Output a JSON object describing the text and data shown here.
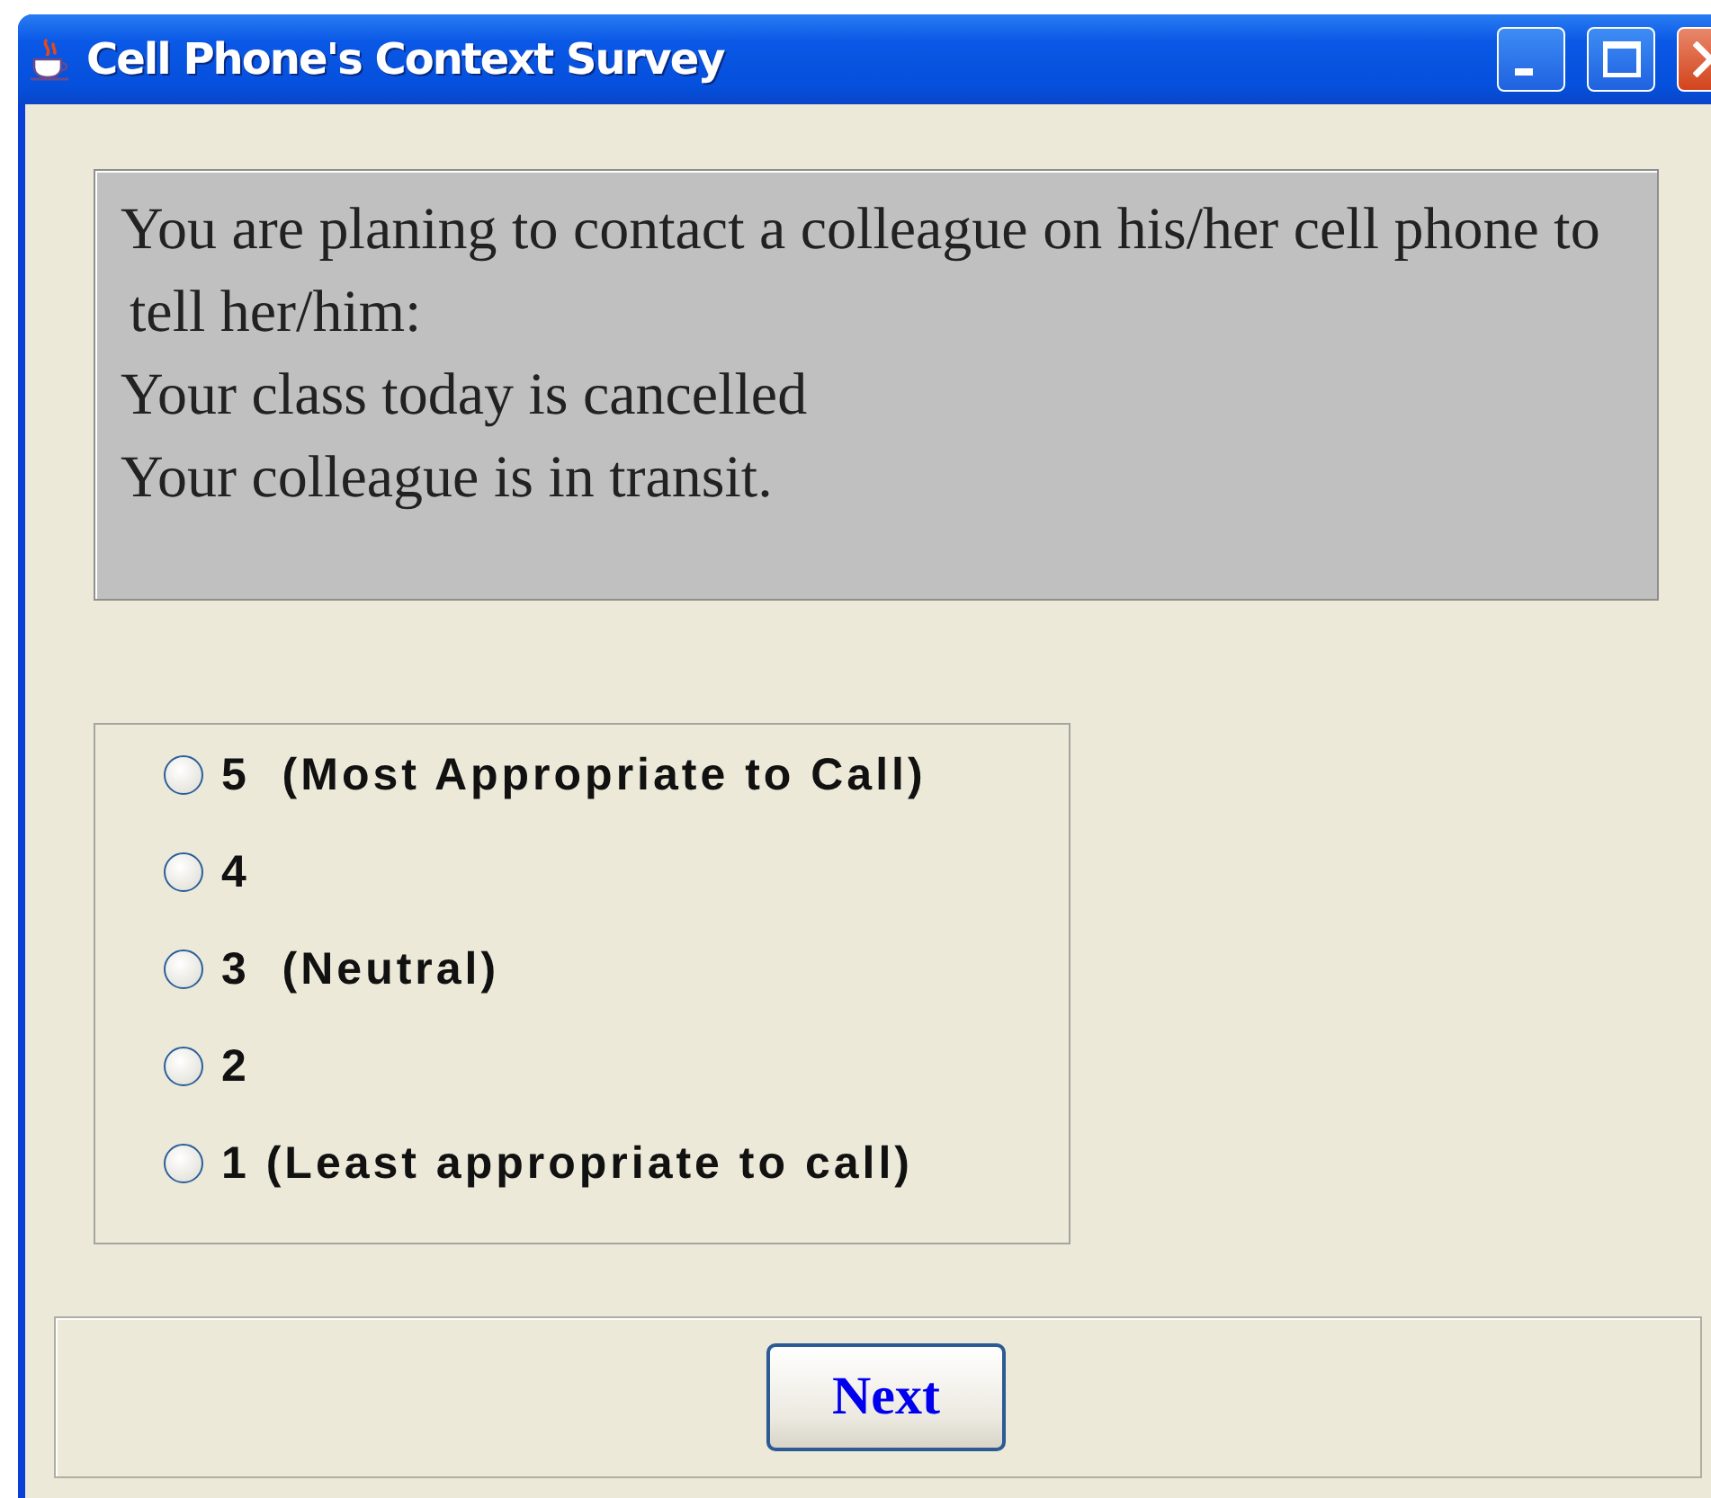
{
  "window": {
    "title": "Cell Phone's Context Survey"
  },
  "message": {
    "lines": [
      "You are planing to contact a colleague on his/her cell phone to",
      "tell her/him:",
      "Your class today is cancelled",
      "Your colleague is in transit."
    ]
  },
  "options": [
    {
      "label": "5  (Most Appropriate to Call)",
      "selected": false
    },
    {
      "label": "4",
      "selected": false
    },
    {
      "label": "3  (Neutral)",
      "selected": false
    },
    {
      "label": "2",
      "selected": false
    },
    {
      "label": "1 (Least appropriate to call)",
      "selected": false
    }
  ],
  "buttons": [
    {
      "label": "Next"
    }
  ]
}
